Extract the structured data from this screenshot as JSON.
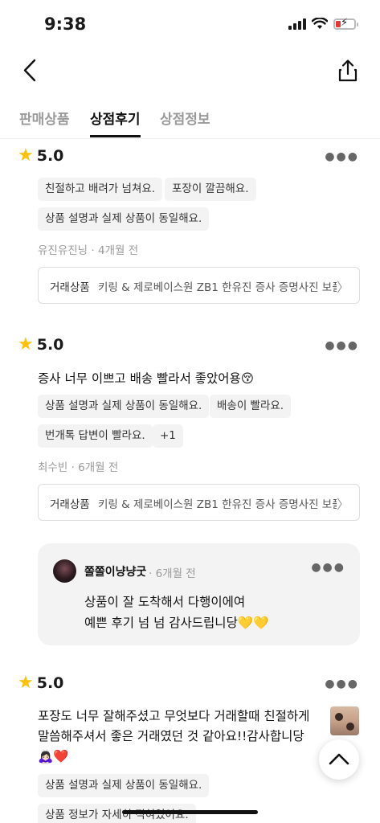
{
  "status": {
    "time": "9:38"
  },
  "tabs": [
    {
      "label": "판매상품"
    },
    {
      "label": "상점후기"
    },
    {
      "label": "상점정보"
    }
  ],
  "reviews": [
    {
      "rating": "5.0",
      "tags": [
        "친절하고 배려가 넘쳐요.",
        "포장이 깔끔해요.",
        "상품 설명과 실제 상품이 동일해요."
      ],
      "author": "유진유진닝",
      "time": "· 4개월 전",
      "product_label": "거래상품",
      "product_name": "키링 & 제로베이스원 ZB1 한유진 증사 증명사진 보플"
    },
    {
      "rating": "5.0",
      "text": "증사 너무 이쁘고 배송 빨라서 좋았어용😚",
      "tags": [
        "상품 설명과 실제 상품이 동일해요.",
        "배송이 빨라요.",
        "번개톡 답변이 빨라요.",
        "+1"
      ],
      "author": "최수빈",
      "time": "· 6개월 전",
      "product_label": "거래상품",
      "product_name": "키링 & 제로베이스원 ZB1 한유진 증사 증명사진 보플",
      "reply": {
        "name": "쫄쫄이냥냥굿",
        "time": "· 6개월 전",
        "line1": "상품이 잘 도착해서 다행이에여",
        "line2": "예쁜 후기 넘 넘 감사드립니당💛💛"
      }
    },
    {
      "rating": "5.0",
      "text_line1": "포장도 너무 잘해주셨고 무엇보다 거래할때 친절하게",
      "text_line2": "말씀해주셔서 좋은 거래였던 것 같아요!!감사합니당",
      "text_line3": "🙇🏻‍♀️❤️",
      "tags": [
        "상품 설명과 실제 상품이 동일해요.",
        "상품 정보가 자세히 적혀있어요."
      ]
    }
  ],
  "icons": {
    "back": "chevron-left-icon",
    "share": "share-icon",
    "more": "more-horizontal-icon",
    "star": "star-icon",
    "scroll_top": "chevron-up-icon"
  },
  "colors": {
    "star": "#ffc107",
    "accent": "#111111",
    "muted": "#9a9a9a",
    "battery_low": "#e53935"
  }
}
